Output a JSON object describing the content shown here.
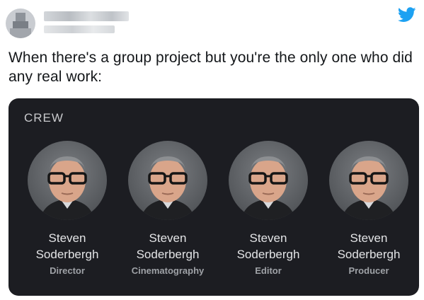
{
  "tweet": {
    "text": "When there's a group project but you're the only one who did any real work:"
  },
  "crew": {
    "heading": "CREW",
    "members": [
      {
        "name_first": "Steven",
        "name_last": "Soderbergh",
        "role": "Director"
      },
      {
        "name_first": "Steven",
        "name_last": "Soderbergh",
        "role": "Cinematography"
      },
      {
        "name_first": "Steven",
        "name_last": "Soderbergh",
        "role": "Editor"
      },
      {
        "name_first": "Steven",
        "name_last": "Soderbergh",
        "role": "Producer"
      }
    ]
  },
  "icons": {
    "brand": "twitter-bird-icon",
    "avatar": "person-photo"
  },
  "colors": {
    "twitter_blue": "#1da1f2",
    "card_background": "#1c1d22",
    "text_primary": "#14171a"
  }
}
